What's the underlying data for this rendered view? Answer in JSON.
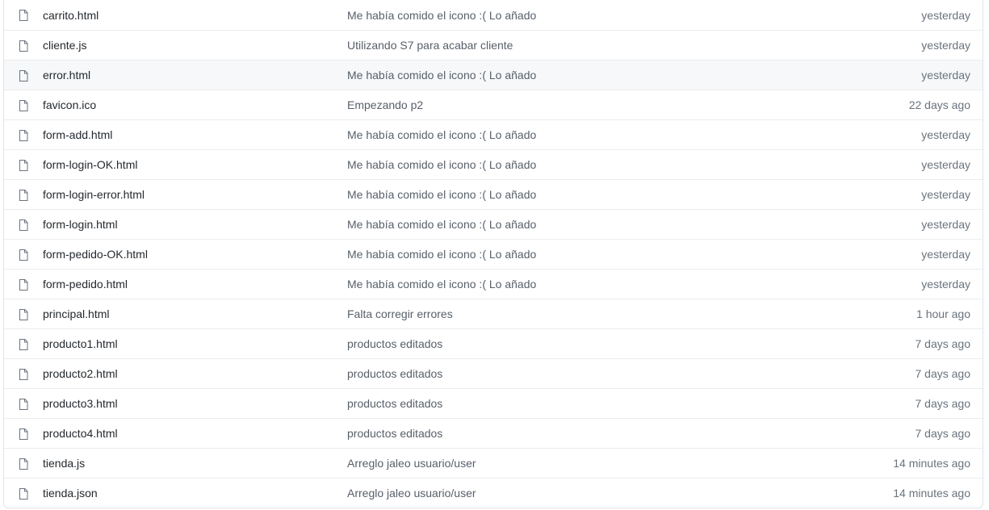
{
  "files": [
    {
      "icon": "file-icon",
      "name": "carrito.html",
      "message": "Me había comido el icono :( Lo añado",
      "age": "yesterday"
    },
    {
      "icon": "file-icon",
      "name": "cliente.js",
      "message": "Utilizando S7 para acabar cliente",
      "age": "yesterday"
    },
    {
      "icon": "file-icon",
      "name": "error.html",
      "message": "Me había comido el icono :( Lo añado",
      "age": "yesterday"
    },
    {
      "icon": "file-icon",
      "name": "favicon.ico",
      "message": "Empezando p2",
      "age": "22 days ago"
    },
    {
      "icon": "file-icon",
      "name": "form-add.html",
      "message": "Me había comido el icono :( Lo añado",
      "age": "yesterday"
    },
    {
      "icon": "file-icon",
      "name": "form-login-OK.html",
      "message": "Me había comido el icono :( Lo añado",
      "age": "yesterday"
    },
    {
      "icon": "file-icon",
      "name": "form-login-error.html",
      "message": "Me había comido el icono :( Lo añado",
      "age": "yesterday"
    },
    {
      "icon": "file-icon",
      "name": "form-login.html",
      "message": "Me había comido el icono :( Lo añado",
      "age": "yesterday"
    },
    {
      "icon": "file-icon",
      "name": "form-pedido-OK.html",
      "message": "Me había comido el icono :( Lo añado",
      "age": "yesterday"
    },
    {
      "icon": "file-icon",
      "name": "form-pedido.html",
      "message": "Me había comido el icono :( Lo añado",
      "age": "yesterday"
    },
    {
      "icon": "file-icon",
      "name": "principal.html",
      "message": "Falta corregir errores",
      "age": "1 hour ago"
    },
    {
      "icon": "file-icon",
      "name": "producto1.html",
      "message": "productos editados",
      "age": "7 days ago"
    },
    {
      "icon": "file-icon",
      "name": "producto2.html",
      "message": "productos editados",
      "age": "7 days ago"
    },
    {
      "icon": "file-icon",
      "name": "producto3.html",
      "message": "productos editados",
      "age": "7 days ago"
    },
    {
      "icon": "file-icon",
      "name": "producto4.html",
      "message": "productos editados",
      "age": "7 days ago"
    },
    {
      "icon": "file-icon",
      "name": "tienda.js",
      "message": "Arreglo jaleo usuario/user",
      "age": "14 minutes ago"
    },
    {
      "icon": "file-icon",
      "name": "tienda.json",
      "message": "Arreglo jaleo usuario/user",
      "age": "14 minutes ago"
    }
  ],
  "hovered_row": 2,
  "colors": {
    "hover_background": "#f6f8fa",
    "border": "#e1e4e8",
    "icon": "#6a737d"
  }
}
